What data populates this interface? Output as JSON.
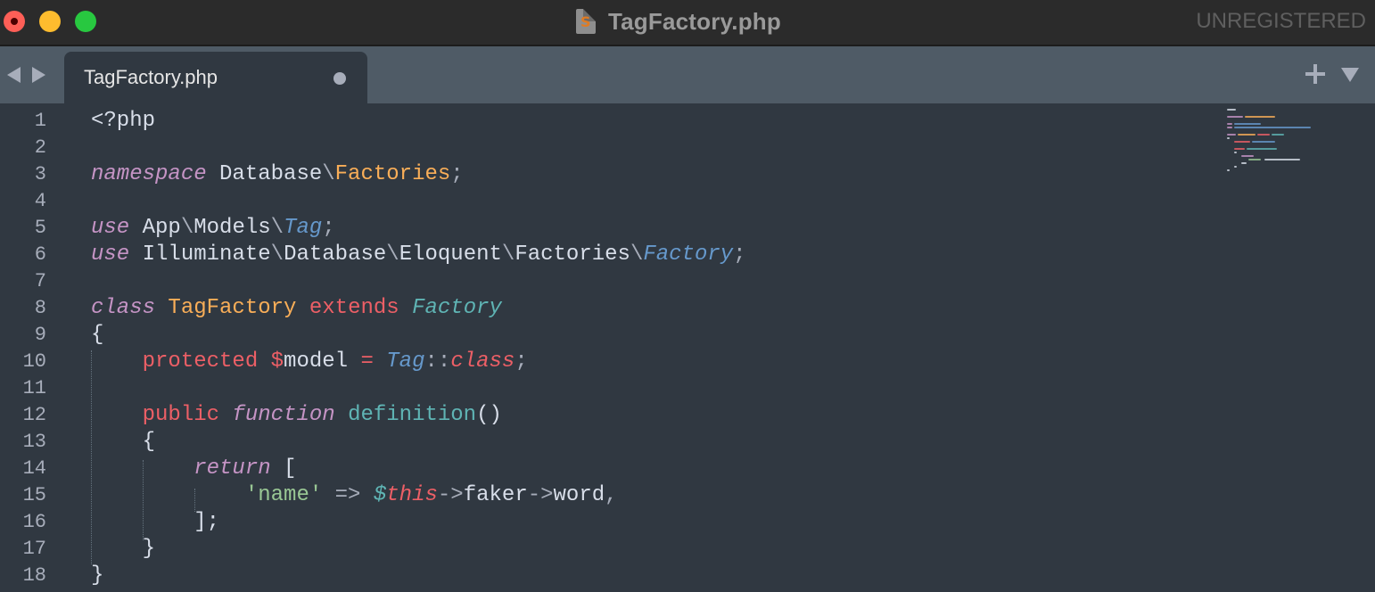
{
  "window": {
    "title": "TagFactory.php",
    "registration_status": "UNREGISTERED"
  },
  "tabs": [
    {
      "label": "TagFactory.php",
      "modified": true
    }
  ],
  "icons": {
    "traffic_lights": [
      "close-icon",
      "minimize-icon",
      "zoom-icon"
    ],
    "nav": [
      "arrow-left-icon",
      "arrow-right-icon"
    ],
    "tab_actions": [
      "plus-icon",
      "chevron-down-icon"
    ],
    "file": "sublime-file-icon"
  },
  "colors": {
    "background": "#303841",
    "tabbar": "#4f5b66",
    "titlebar": "#2b2b2b",
    "keyword_purple": "#c594c5",
    "keyword_red": "#ec5f66",
    "class_orange": "#f9ae58",
    "type_blue": "#6699cc",
    "type_teal": "#5fb4b4",
    "string_green": "#99c794"
  },
  "editor": {
    "line_numbers": [
      "1",
      "2",
      "3",
      "4",
      "5",
      "6",
      "7",
      "8",
      "9",
      "10",
      "11",
      "12",
      "13",
      "14",
      "15",
      "16",
      "17",
      "18"
    ],
    "lines": [
      {
        "tokens": [
          {
            "t": "<?php",
            "c": "plain"
          }
        ]
      },
      {
        "tokens": []
      },
      {
        "tokens": [
          {
            "t": "namespace",
            "c": "kw-italic"
          },
          {
            "t": " Database",
            "c": "plain"
          },
          {
            "t": "\\",
            "c": "punc"
          },
          {
            "t": "Factories",
            "c": "cls-orange"
          },
          {
            "t": ";",
            "c": "punc"
          }
        ]
      },
      {
        "tokens": []
      },
      {
        "tokens": [
          {
            "t": "use",
            "c": "kw-italic"
          },
          {
            "t": " App",
            "c": "plain"
          },
          {
            "t": "\\",
            "c": "punc"
          },
          {
            "t": "Models",
            "c": "plain"
          },
          {
            "t": "\\",
            "c": "punc"
          },
          {
            "t": "Tag",
            "c": "type-blue"
          },
          {
            "t": ";",
            "c": "punc"
          }
        ]
      },
      {
        "tokens": [
          {
            "t": "use",
            "c": "kw-italic"
          },
          {
            "t": " Illuminate",
            "c": "plain"
          },
          {
            "t": "\\",
            "c": "punc"
          },
          {
            "t": "Database",
            "c": "plain"
          },
          {
            "t": "\\",
            "c": "punc"
          },
          {
            "t": "Eloquent",
            "c": "plain"
          },
          {
            "t": "\\",
            "c": "punc"
          },
          {
            "t": "Factories",
            "c": "plain"
          },
          {
            "t": "\\",
            "c": "punc"
          },
          {
            "t": "Factory",
            "c": "type-blue"
          },
          {
            "t": ";",
            "c": "punc"
          }
        ]
      },
      {
        "tokens": []
      },
      {
        "tokens": [
          {
            "t": "class",
            "c": "kw-italic"
          },
          {
            "t": " ",
            "c": "plain"
          },
          {
            "t": "TagFactory",
            "c": "cls-orange"
          },
          {
            "t": " ",
            "c": "plain"
          },
          {
            "t": "extends",
            "c": "kw-red"
          },
          {
            "t": " ",
            "c": "plain"
          },
          {
            "t": "Factory",
            "c": "type-teal"
          }
        ]
      },
      {
        "tokens": [
          {
            "t": "{",
            "c": "plain"
          }
        ]
      },
      {
        "tokens": [
          {
            "t": "    ",
            "c": "plain"
          },
          {
            "t": "protected",
            "c": "kw-red"
          },
          {
            "t": " ",
            "c": "plain"
          },
          {
            "t": "$",
            "c": "kw-red"
          },
          {
            "t": "model",
            "c": "plain"
          },
          {
            "t": " ",
            "c": "plain"
          },
          {
            "t": "=",
            "c": "kw-red"
          },
          {
            "t": " ",
            "c": "plain"
          },
          {
            "t": "Tag",
            "c": "type-blue"
          },
          {
            "t": "::",
            "c": "punc"
          },
          {
            "t": "class",
            "c": "var-red-i"
          },
          {
            "t": ";",
            "c": "punc"
          }
        ]
      },
      {
        "tokens": []
      },
      {
        "tokens": [
          {
            "t": "    ",
            "c": "plain"
          },
          {
            "t": "public",
            "c": "kw-red"
          },
          {
            "t": " ",
            "c": "plain"
          },
          {
            "t": "function",
            "c": "kw-italic"
          },
          {
            "t": " ",
            "c": "plain"
          },
          {
            "t": "definition",
            "c": "fn-teal"
          },
          {
            "t": "()",
            "c": "plain"
          }
        ]
      },
      {
        "tokens": [
          {
            "t": "    {",
            "c": "plain"
          }
        ]
      },
      {
        "tokens": [
          {
            "t": "        ",
            "c": "plain"
          },
          {
            "t": "return",
            "c": "kw-italic"
          },
          {
            "t": " [",
            "c": "plain"
          }
        ]
      },
      {
        "tokens": [
          {
            "t": "            ",
            "c": "plain"
          },
          {
            "t": "'name'",
            "c": "str-green"
          },
          {
            "t": " ",
            "c": "plain"
          },
          {
            "t": "=>",
            "c": "punc"
          },
          {
            "t": " ",
            "c": "plain"
          },
          {
            "t": "$",
            "c": "type-teal"
          },
          {
            "t": "this",
            "c": "var-red-i"
          },
          {
            "t": "->",
            "c": "punc"
          },
          {
            "t": "faker",
            "c": "plain"
          },
          {
            "t": "->",
            "c": "punc"
          },
          {
            "t": "word",
            "c": "plain"
          },
          {
            "t": ",",
            "c": "punc"
          }
        ]
      },
      {
        "tokens": [
          {
            "t": "        ];",
            "c": "plain"
          }
        ]
      },
      {
        "tokens": [
          {
            "t": "    }",
            "c": "plain"
          }
        ]
      },
      {
        "tokens": [
          {
            "t": "}",
            "c": "plain"
          }
        ]
      }
    ]
  }
}
